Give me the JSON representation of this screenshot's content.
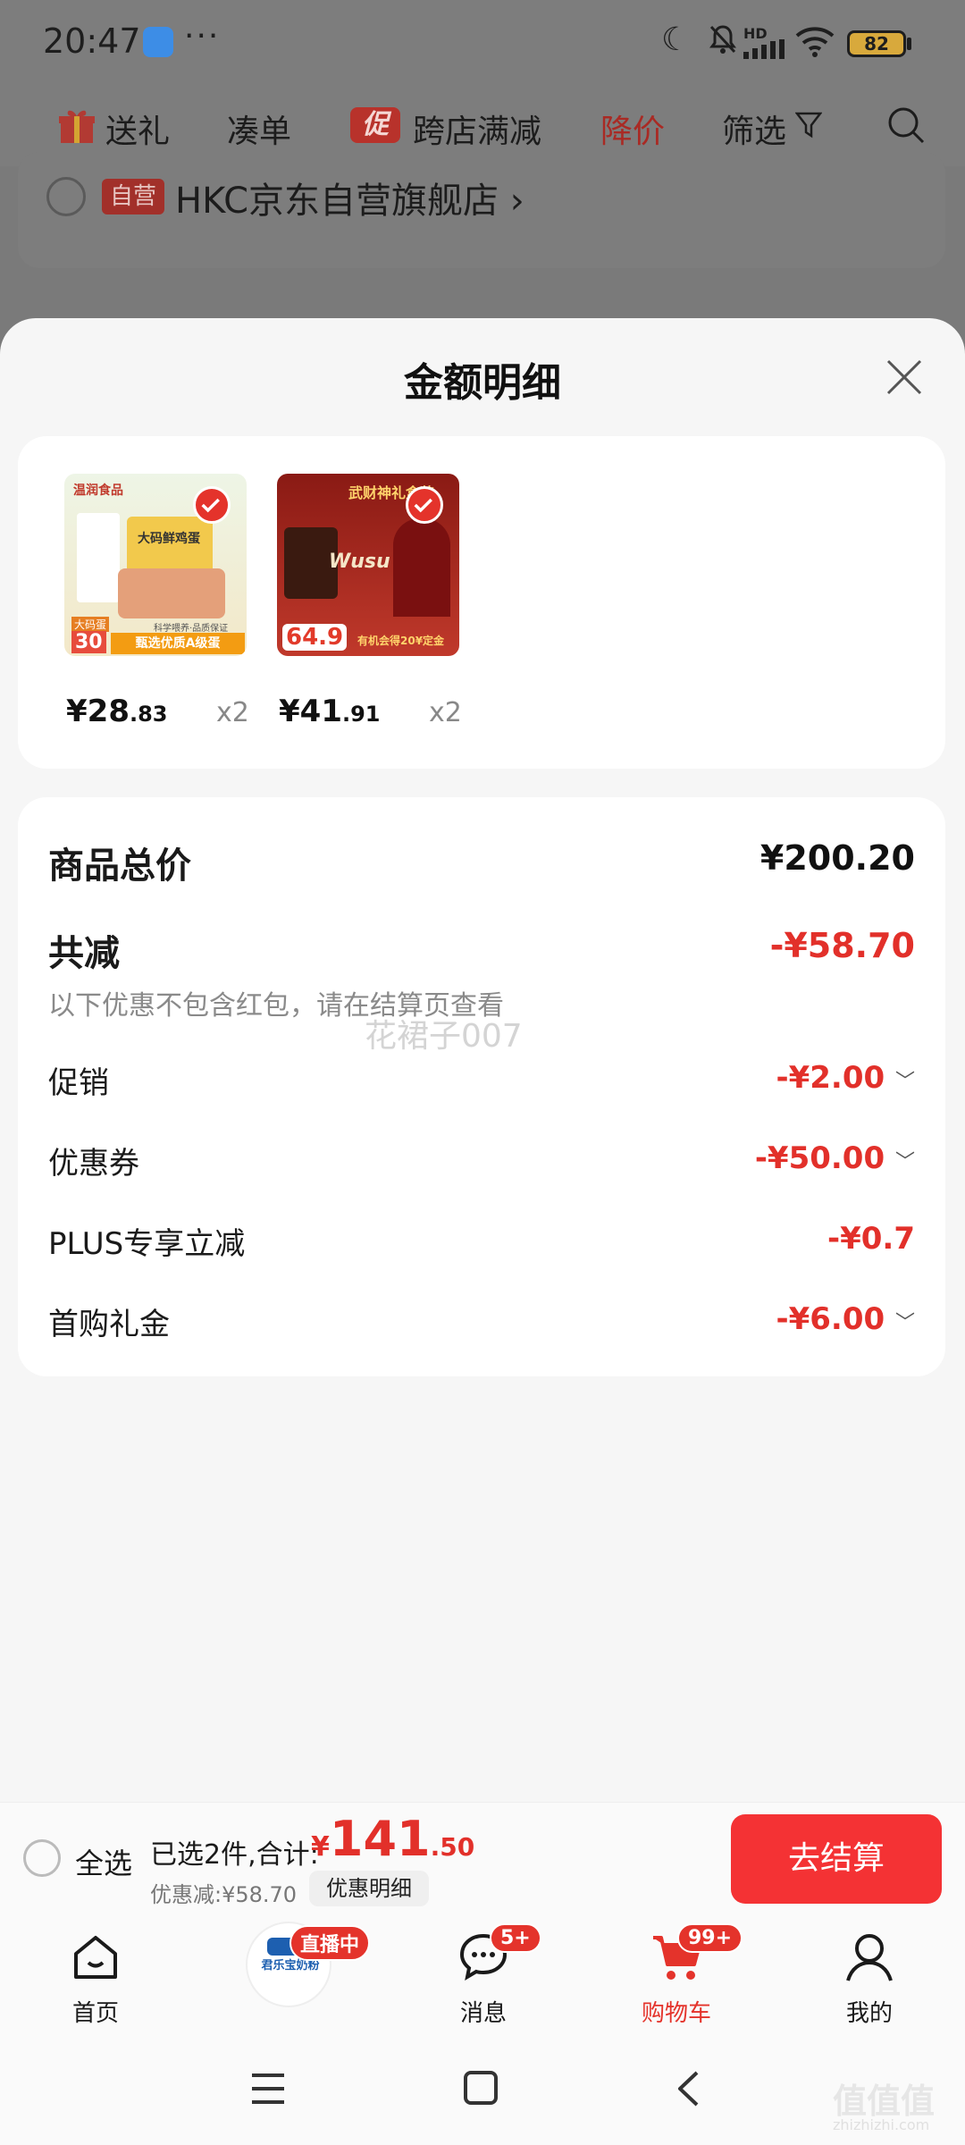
{
  "status_bar": {
    "time": "20:47",
    "dots": "···",
    "hd": "HD",
    "battery": "82"
  },
  "filter_bar": {
    "items": [
      "送礼",
      "凑单",
      "跨店满减",
      "降价",
      "筛选"
    ],
    "promo_badge": "促",
    "active_color": "#e2302a"
  },
  "store": {
    "badge": "自营",
    "name": "HKC京东自营旗舰店 ›"
  },
  "sheet": {
    "title": "金额明细",
    "products": [
      {
        "price_int": "¥28",
        "price_dec": ".83",
        "qty": "x2",
        "thumb_text": [
          "温润食品",
          "大码鲜鸡蛋",
          "大码蛋",
          "30",
          "甄选优质A级蛋",
          "科学喂养·品质保证"
        ]
      },
      {
        "price_int": "¥41",
        "price_dec": ".91",
        "qty": "x2",
        "thumb_text": [
          "武财神礼盒装",
          "Wusu",
          "64.9",
          "有机会得20¥定金"
        ]
      }
    ],
    "summary": {
      "total_label": "商品总价",
      "total_value": "¥200.20",
      "discount_label": "共减",
      "discount_value": "-¥58.70",
      "hint": "以下优惠不包含红包，请在结算页查看",
      "watermark": "花裙子007",
      "rows": [
        {
          "label": "促销",
          "value": "-¥2.00",
          "chevron": "﹀"
        },
        {
          "label": "优惠券",
          "value": "-¥50.00",
          "chevron": "﹀"
        },
        {
          "label": "PLUS专享立减",
          "value": "-¥0.7",
          "chevron": ""
        },
        {
          "label": "首购礼金",
          "value": "-¥6.00",
          "chevron": "﹀"
        }
      ]
    }
  },
  "checkout": {
    "select_all": "全选",
    "selected": "已选2件,合计:",
    "currency": "¥",
    "total_int": "141",
    "total_dec": ".50",
    "discount": "优惠减:¥58.70",
    "detail_button": "优惠明细",
    "pay_button": "去结算"
  },
  "tabbar": {
    "items": [
      {
        "label": "首页",
        "badge": ""
      },
      {
        "label": "君乐宝奶粉",
        "badge": "直播中"
      },
      {
        "label": "消息",
        "badge": "5+"
      },
      {
        "label": "购物车",
        "badge": "99+"
      },
      {
        "label": "我的",
        "badge": ""
      }
    ]
  },
  "watermark_site": {
    "mark": "值值值",
    "url": "zhizhizhi.com"
  }
}
